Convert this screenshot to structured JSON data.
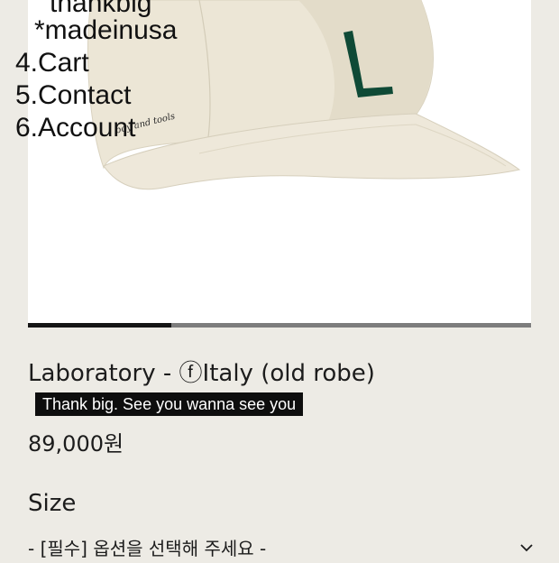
{
  "product": {
    "title": "Laboratory - ⓕItaly (old robe)",
    "tagline": "Thank big. See you wanna see you",
    "price": "89,000원",
    "image_alt": "Cream baseball cap with green L logo",
    "cap_embroidery": "boy and tools",
    "gallery_progress": 0.285
  },
  "overlay_menu": {
    "items": [
      "thankbig",
      "*madeinusa",
      "4.Cart",
      "5.Contact",
      "6.Account"
    ]
  },
  "options": {
    "size_label": "Size",
    "size_select_text": "- [필수] 옵션을 선택해 주세요 -",
    "chevron_icon": "chevron-down-icon"
  },
  "colors": {
    "page_background": "#edebe5",
    "cap_fabric": "#e9e3d2",
    "logo_green": "#0f4a36",
    "tag_background": "#0e0e0e"
  }
}
